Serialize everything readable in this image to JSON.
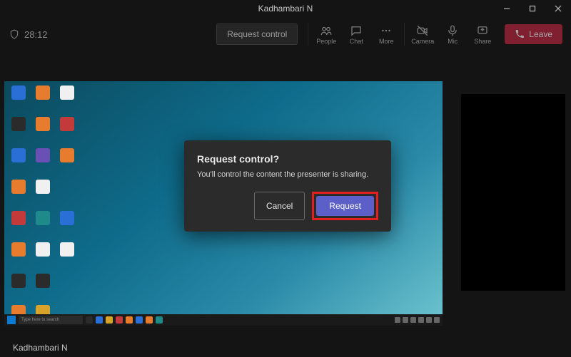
{
  "titlebar": {
    "title": "Kadhambari N"
  },
  "topbar": {
    "time": "28:12",
    "request_control_label": "Request control",
    "people_label": "People",
    "chat_label": "Chat",
    "more_label": "More",
    "camera_label": "Camera",
    "mic_label": "Mic",
    "share_label": "Share",
    "leave_label": "Leave"
  },
  "dialog": {
    "title": "Request control?",
    "body": "You'll control the content the presenter is sharing.",
    "cancel_label": "Cancel",
    "request_label": "Request"
  },
  "taskbar": {
    "search_placeholder": "Type here to search"
  },
  "caption": {
    "name": "Kadhambari N"
  }
}
